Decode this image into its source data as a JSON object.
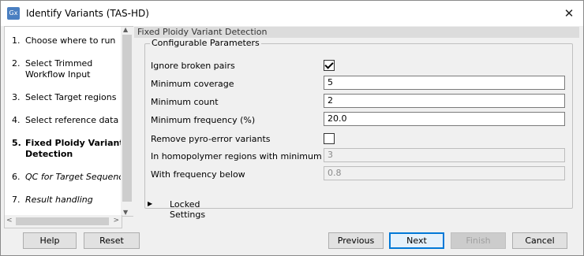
{
  "window": {
    "title": "Identify Variants (TAS-HD)",
    "app_icon_text": "Gx"
  },
  "steps": [
    {
      "num": "1.",
      "label": "Choose where to run"
    },
    {
      "num": "2.",
      "label": "Select Trimmed Workflow Input"
    },
    {
      "num": "3.",
      "label": "Select Target regions"
    },
    {
      "num": "4.",
      "label": "Select reference data set"
    },
    {
      "num": "5.",
      "label": "Fixed Ploidy Variant Detection"
    },
    {
      "num": "6.",
      "label": "QC for Target Sequencing"
    },
    {
      "num": "7.",
      "label": "Result handling"
    }
  ],
  "panel": {
    "header": "Fixed Ploidy Variant Detection",
    "group_title": "Configurable Parameters",
    "params": {
      "ignore_broken_pairs": {
        "label": "Ignore broken pairs",
        "checked": true
      },
      "min_coverage": {
        "label": "Minimum coverage",
        "value": "5"
      },
      "min_count": {
        "label": "Minimum count",
        "value": "2"
      },
      "min_frequency": {
        "label": "Minimum frequency (%)",
        "value": "20.0"
      },
      "remove_pyro": {
        "label": "Remove pyro-error variants",
        "checked": false
      },
      "homopolymer_min_length": {
        "label": "In homopolymer regions with minimum length",
        "value": "3"
      },
      "freq_below": {
        "label": "With frequency below",
        "value": "0.8"
      }
    },
    "locked_settings": "Locked Settings"
  },
  "buttons": {
    "help": "Help",
    "reset": "Reset",
    "previous": "Previous",
    "next": "Next",
    "finish": "Finish",
    "cancel": "Cancel"
  }
}
